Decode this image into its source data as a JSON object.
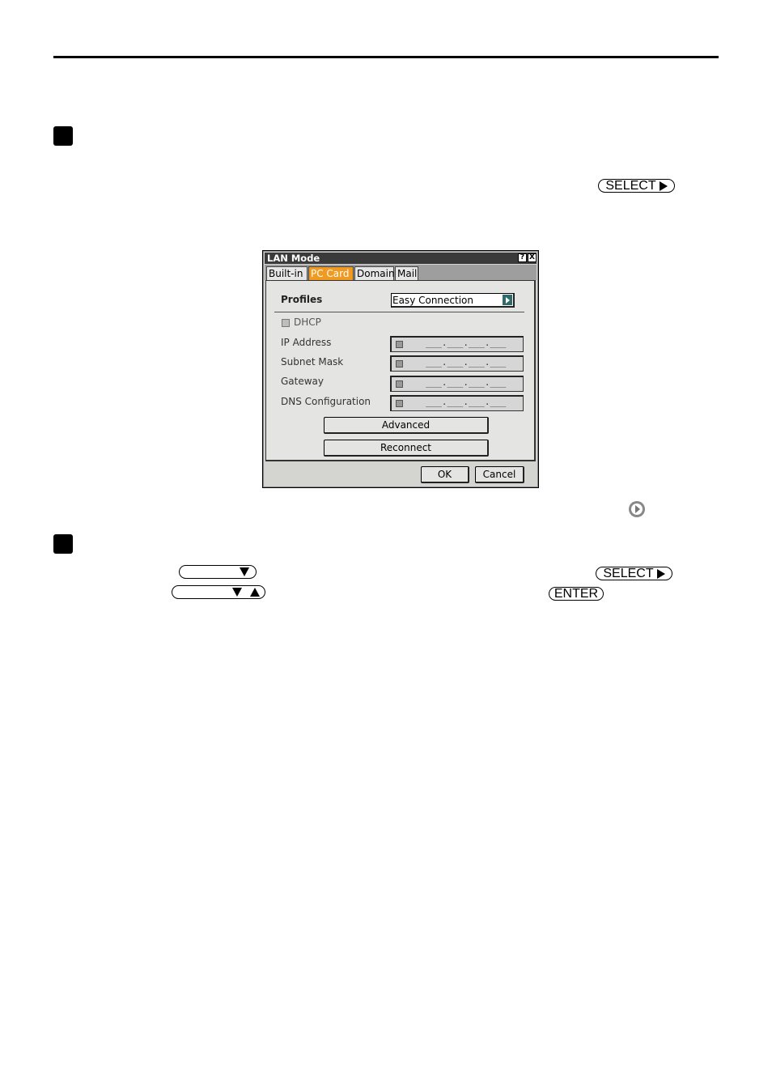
{
  "keys": {
    "select_1": "SELECT",
    "select_2": "SELECT",
    "enter": "ENTER"
  },
  "dialog": {
    "title": "LAN Mode",
    "help_button": "?",
    "close_button": "X",
    "tabs": [
      {
        "label": "Built-in",
        "active": false
      },
      {
        "label": "PC Card",
        "active": true
      },
      {
        "label": "Domain",
        "active": false
      },
      {
        "label": "Mail",
        "active": false
      }
    ],
    "profiles_label": "Profiles",
    "profiles_value": "Easy Connection",
    "dhcp_label": "DHCP",
    "fields": [
      {
        "label": "IP Address",
        "value": "___.___.___.___"
      },
      {
        "label": "Subnet Mask",
        "value": "___.___.___.___"
      },
      {
        "label": "Gateway",
        "value": "___.___.___.___"
      },
      {
        "label": "DNS Configuration",
        "value": "___.___.___.___"
      }
    ],
    "advanced_button": "Advanced",
    "reconnect_button": "Reconnect",
    "ok_button": "OK",
    "cancel_button": "Cancel"
  },
  "colors": {
    "active_tab": "#f19a22",
    "titlebar": "#3a3a3a",
    "dropdown_arrow": "#2f6b6b"
  }
}
